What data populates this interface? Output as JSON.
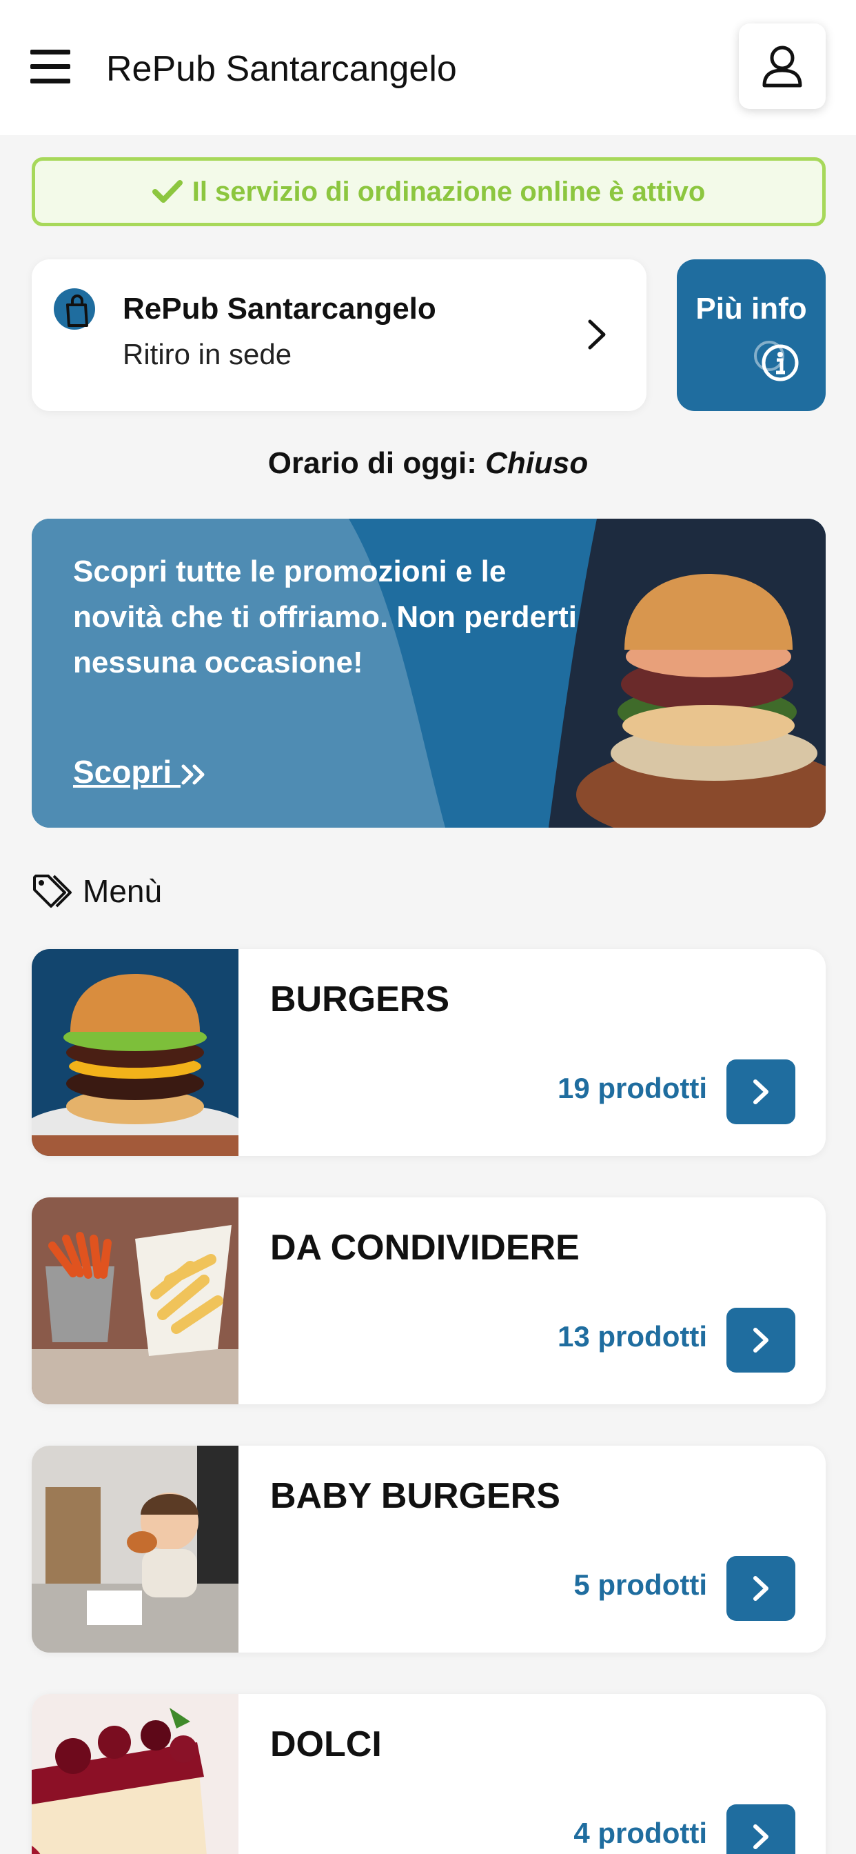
{
  "header": {
    "title": "RePub Santarcangelo",
    "menu_icon": "hamburger-icon",
    "user_icon": "user-icon"
  },
  "status": {
    "text": "Il servizio di ordinazione online è attivo",
    "icon": "check-icon",
    "color": "#8cc63f"
  },
  "pickup": {
    "name": "RePub Santarcangelo",
    "mode": "Ritiro in sede",
    "icon": "shopping-bag-icon"
  },
  "info_button": {
    "label": "Più info",
    "icon": "info-icon"
  },
  "hours": {
    "prefix": "Orario di oggi:",
    "value": "Chiuso"
  },
  "promo": {
    "text": "Scopri tutte le promozioni e le novità che ti offriamo. Non perderti nessuna occasione!",
    "link": "Scopri "
  },
  "menu": {
    "heading": "Menù",
    "categories": [
      {
        "name": "BURGERS",
        "count": "19 prodotti"
      },
      {
        "name": "DA CONDIVIDERE",
        "count": "13 prodotti"
      },
      {
        "name": "BABY BURGERS",
        "count": "5 prodotti"
      },
      {
        "name": "DOLCI",
        "count": "4 prodotti"
      }
    ]
  },
  "colors": {
    "accent": "#1f6d9f",
    "success": "#8cc63f"
  }
}
